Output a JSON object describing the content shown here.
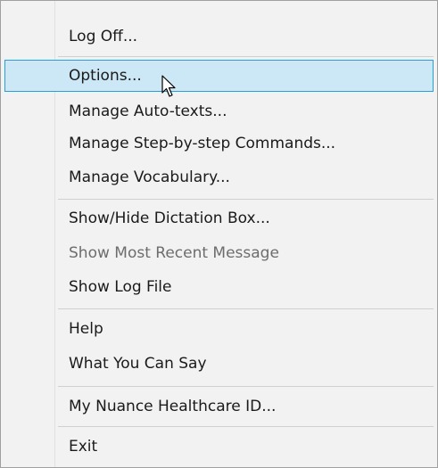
{
  "menu": {
    "items": [
      {
        "label": "Log Off...",
        "disabled": false
      },
      {
        "label": "Options...",
        "disabled": false,
        "highlighted": true
      },
      {
        "label": "Manage Auto-texts...",
        "disabled": false
      },
      {
        "label": "Manage Step-by-step Commands...",
        "disabled": false
      },
      {
        "label": "Manage Vocabulary...",
        "disabled": false
      },
      {
        "label": "Show/Hide Dictation Box...",
        "disabled": false
      },
      {
        "label": "Show Most Recent Message",
        "disabled": true
      },
      {
        "label": "Show Log File",
        "disabled": false
      },
      {
        "label": "Help",
        "disabled": false
      },
      {
        "label": "What You Can Say",
        "disabled": false
      },
      {
        "label": "My Nuance Healthcare ID...",
        "disabled": false
      },
      {
        "label": "Exit",
        "disabled": false
      }
    ]
  },
  "colors": {
    "highlight_fill": "#cce8f6",
    "highlight_border": "#26a0da",
    "menu_background": "#f2f2f2",
    "disabled_text": "#6d6d6d"
  },
  "icons": {
    "cursor": "mouse-pointer-arrow-icon"
  }
}
